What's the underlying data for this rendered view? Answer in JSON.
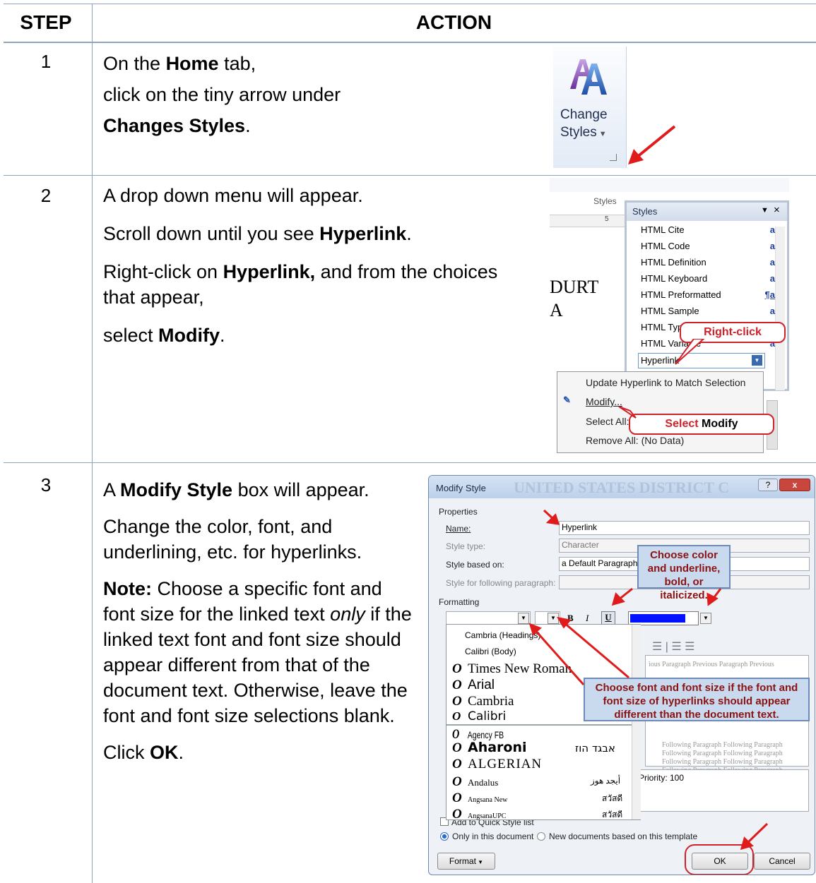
{
  "table": {
    "header_step": "STEP",
    "header_action": "ACTION"
  },
  "steps": [
    {
      "num": "1",
      "line1_pre": "On the ",
      "line1_bold": "Home",
      "line1_post": " tab,",
      "line2": "click on the tiny arrow under",
      "line3_bold": "Changes Styles",
      "line3_post": "."
    },
    {
      "num": "2",
      "p1": "A drop down menu will appear.",
      "p2_pre": "Scroll down until you see ",
      "p2_bold": "Hyperlink",
      "p2_post": ".",
      "p3_pre": "Right-click on ",
      "p3_bold": "Hyperlink,",
      "p3_post": " and from the choices that appear,",
      "p4_pre": "select ",
      "p4_bold": "Modify",
      "p4_post": "."
    },
    {
      "num": "3",
      "p1_pre": "A ",
      "p1_bold": "Modify Style",
      "p1_post": " box will appear.",
      "p2": "Change the color, font, and underlining, etc. for hyperlinks.",
      "p3_bold": "Note:",
      "p3_a": "  Choose a specific font and font size for the linked text ",
      "p3_italic": "only",
      "p3_b": " if the linked text font and font size should appear different from that of the document text.  Otherwise, leave the font and font size selections blank.",
      "p4_pre": "Click ",
      "p4_bold": "OK",
      "p4_post": "."
    }
  ],
  "shot1": {
    "label_line1": "Change",
    "label_line2": "Styles"
  },
  "shot2": {
    "ribbon_label": "Styles",
    "ruler_num": "5",
    "doc_text1": "DURT",
    "doc_text2": "A",
    "pane_title": "Styles",
    "styles": [
      "HTML Cite",
      "HTML Code",
      "HTML Definition",
      "HTML Keyboard",
      "HTML Preformatted",
      "HTML Sample",
      "HTML Typ",
      "HTML Variable",
      "Hyperlink"
    ],
    "style_markers": [
      "a",
      "a",
      "a",
      "a",
      "¶a",
      "a",
      "",
      "a",
      ""
    ],
    "callout_rightclick": "Right-click",
    "menu_items": [
      "Update Hyperlink to Match Selection",
      "Modify...",
      "Select All:",
      "Remove All: (No Data)"
    ],
    "callout_select_a": "Select",
    "callout_select_b": " Modify"
  },
  "shot3": {
    "title": "Modify Style",
    "help": "?",
    "close": "x",
    "bg_text": "UNITED STATES DISTRICT C",
    "properties": "Properties",
    "name_label": "Name:",
    "name_value": "Hyperlink",
    "type_label": "Style type:",
    "type_value": "Character",
    "based_label": "Style based on:",
    "based_value": "a Default Paragraph Font",
    "following_label": "Style for following paragraph:",
    "formatting": "Formatting",
    "bold_btn": "B",
    "italic_btn": "I",
    "underline_btn": "U",
    "callout_color": "Choose color and underline, bold, or italicized.",
    "fonts_top": [
      "Cambria (Headings)",
      "Calibri (Body)"
    ],
    "fonts": [
      {
        "name": "Times New Roman",
        "sample": ""
      },
      {
        "name": "Arial",
        "sample": ""
      },
      {
        "name": "Cambria",
        "sample": ""
      },
      {
        "name": "Calibri",
        "sample": ""
      },
      {
        "name": "Agency FB",
        "sample": ""
      },
      {
        "name": "Aharoni",
        "sample": "אבגד הוז"
      },
      {
        "name": "ALGERIAN",
        "sample": ""
      },
      {
        "name": "Andalus",
        "sample": "أيجد هوز"
      },
      {
        "name": "Angsana New",
        "sample": "สวัสดี"
      },
      {
        "name": "AngsanaUPC",
        "sample": "สวัสดี"
      }
    ],
    "font_prefix": "O",
    "callout_font_a": "Choose font and font size",
    "callout_font_b": " if the font and font size of hyperlinks should appear different than the document text.",
    "preview_line": "ious Paragraph Previous Paragraph Previous",
    "following_lines": [
      "Following Paragraph Following Paragraph",
      "Following Paragraph Following Paragraph",
      "Following Paragraph Following Paragraph",
      "Following Paragraph Following Paragraph"
    ],
    "priority": "Priority: 100",
    "quick_style": "Add to Quick Style list",
    "only_doc": "Only in this document",
    "new_docs": "New documents based on this template",
    "format_btn": "Format",
    "ok_btn": "OK",
    "cancel_btn": "Cancel"
  }
}
